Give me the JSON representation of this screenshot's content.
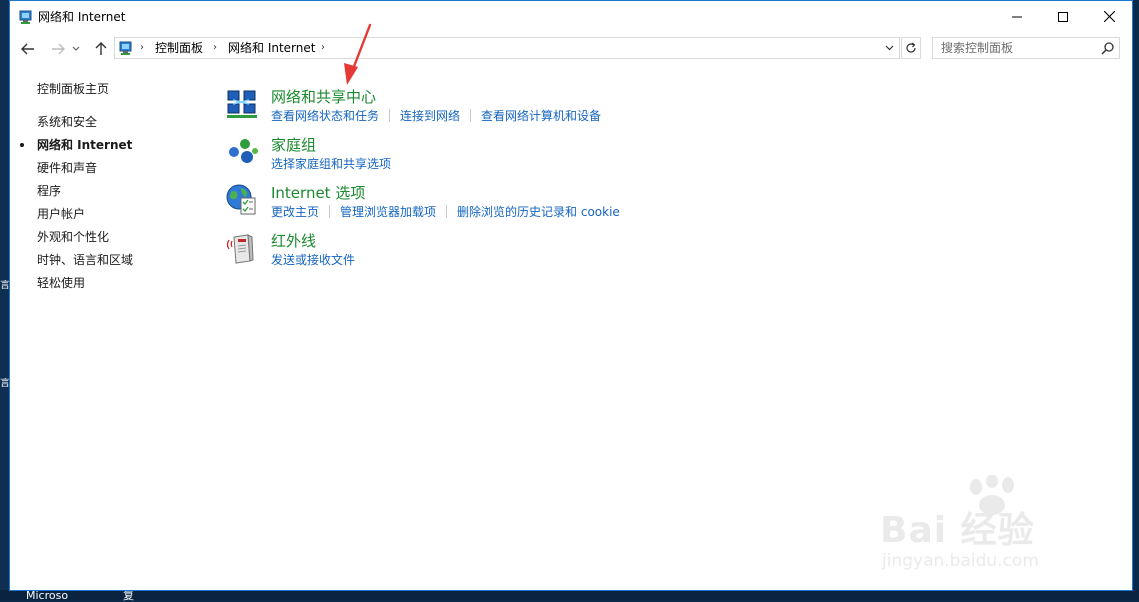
{
  "window": {
    "title": "网络和 Internet"
  },
  "nav": {
    "breadcrumbs": [
      "控制面板",
      "网络和 Internet"
    ],
    "search_placeholder": "搜索控制面板"
  },
  "sidebar": {
    "items": [
      {
        "label": "控制面板主页",
        "active": false
      },
      {
        "label": "系统和安全",
        "active": false
      },
      {
        "label": "网络和 Internet",
        "active": true
      },
      {
        "label": "硬件和声音",
        "active": false
      },
      {
        "label": "程序",
        "active": false
      },
      {
        "label": "用户帐户",
        "active": false
      },
      {
        "label": "外观和个性化",
        "active": false
      },
      {
        "label": "时钟、语言和区域",
        "active": false
      },
      {
        "label": "轻松使用",
        "active": false
      }
    ]
  },
  "categories": [
    {
      "title": "网络和共享中心",
      "icon": "network-sharing-center-icon",
      "links": [
        "查看网络状态和任务",
        "连接到网络",
        "查看网络计算机和设备"
      ]
    },
    {
      "title": "家庭组",
      "icon": "homegroup-icon",
      "links": [
        "选择家庭组和共享选项"
      ]
    },
    {
      "title": "Internet 选项",
      "icon": "internet-options-icon",
      "links": [
        "更改主页",
        "管理浏览器加载项",
        "删除浏览的历史记录和 cookie"
      ]
    },
    {
      "title": "红外线",
      "icon": "infrared-icon",
      "links": [
        "发送或接收文件"
      ]
    }
  ],
  "desktop": {
    "taskbar_labels": [
      "Microso",
      "复"
    ],
    "edge_glyphs": [
      "言",
      "言"
    ]
  },
  "watermark": {
    "brand": "Bai 经验",
    "url": "jingyan.baidu.com"
  },
  "colors": {
    "category_title": "#1a8a2e",
    "link": "#1565c0",
    "annotation_arrow": "#e53935",
    "window_border": "#1b78d2"
  }
}
